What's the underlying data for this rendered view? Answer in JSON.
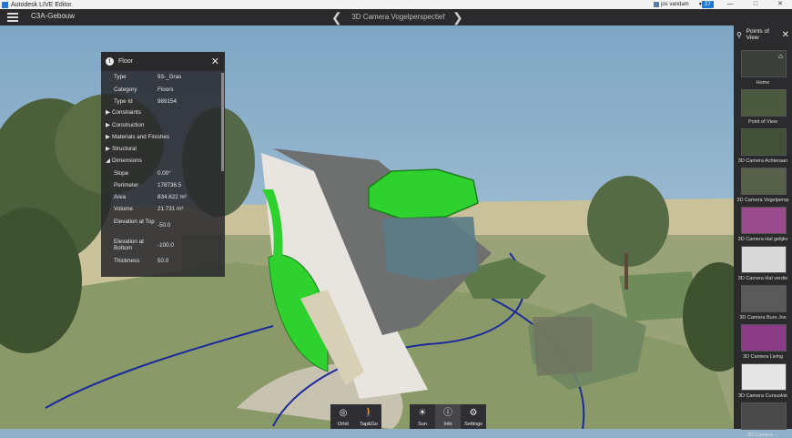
{
  "window": {
    "title": "Autodesk LIVE Editor",
    "user": "jos vandam",
    "badge": "27"
  },
  "appbar": {
    "project": "C3A-Gebouw",
    "view": "3D Camera Vogelperspectief"
  },
  "points_of_view": {
    "title": "Points of View",
    "items": [
      "Home",
      "Point of View",
      "3D Camera Achteraan",
      "3D Camera Vogelpersp",
      "3D Camera Hal gelijkv",
      "3D Camera Hal verdie",
      "3D Camera Buro Jos",
      "3D Camera Living",
      "3D Camera Cursuslok",
      "3D Camera ..."
    ]
  },
  "properties": {
    "title": "Floor",
    "rows": [
      {
        "k": "Type",
        "v": "93-_Gras"
      },
      {
        "k": "Category",
        "v": "Floors"
      },
      {
        "k": "Type Id",
        "v": "989154"
      }
    ],
    "sections": [
      "Constraints",
      "Construction",
      "Materials and Finishes",
      "Structural",
      "Dimensions"
    ],
    "dims": [
      {
        "k": "Slope",
        "v": "0.00°"
      },
      {
        "k": "Perimeter",
        "v": "178736.5"
      },
      {
        "k": "Area",
        "v": "834.622 m²"
      },
      {
        "k": "Volume",
        "v": "21.731 m³"
      },
      {
        "k": "Elevation at Top",
        "v": "-50.0"
      },
      {
        "k": "Elevation at Bottom",
        "v": "-100.0"
      },
      {
        "k": "Thickness",
        "v": "50.0"
      }
    ]
  },
  "toolbar": {
    "orbit": "Orbit",
    "tapgo": "Tap&Go",
    "sun": "Sun",
    "info": "Info",
    "settings": "Settings"
  },
  "colors": {
    "bar": "#2b2b2e",
    "accent": "#1e7ad4",
    "highlight": "#2fd12f"
  }
}
